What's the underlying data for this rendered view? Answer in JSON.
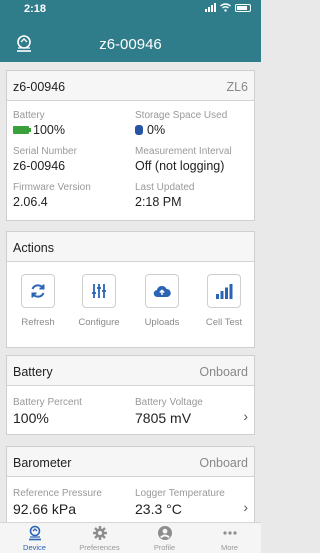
{
  "status_bar": {
    "time": "2:18"
  },
  "header": {
    "title": "z6-00946",
    "logo_icon": "meter-logo-icon"
  },
  "device": {
    "name": "z6-00946",
    "model": "ZL6",
    "fields": {
      "battery_label": "Battery",
      "battery_value": "100%",
      "storage_label": "Storage Space Used",
      "storage_value": "0%",
      "serial_label": "Serial Number",
      "serial_value": "z6-00946",
      "interval_label": "Measurement Interval",
      "interval_value": "Off (not logging)",
      "firmware_label": "Firmware Version",
      "firmware_value": "2.06.4",
      "updated_label": "Last Updated",
      "updated_value": "2:18 PM"
    }
  },
  "actions": {
    "title": "Actions",
    "items": [
      {
        "label": "Refresh",
        "icon": "refresh-icon"
      },
      {
        "label": "Configure",
        "icon": "sliders-icon"
      },
      {
        "label": "Uploads",
        "icon": "cloud-upload-icon"
      },
      {
        "label": "Cell Test",
        "icon": "signal-bars-icon"
      }
    ]
  },
  "battery_section": {
    "title": "Battery",
    "source": "Onboard",
    "percent_label": "Battery Percent",
    "percent_value": "100%",
    "voltage_label": "Battery Voltage",
    "voltage_value": "7805 mV"
  },
  "barometer_section": {
    "title": "Barometer",
    "source": "Onboard",
    "pressure_label": "Reference Pressure",
    "pressure_value": "92.66 kPa",
    "temp_label": "Logger Temperature",
    "temp_value": "23.3 °C"
  },
  "tabs": [
    {
      "label": "Device",
      "icon": "device-icon",
      "active": true
    },
    {
      "label": "Preferences",
      "icon": "gear-icon",
      "active": false
    },
    {
      "label": "Profile",
      "icon": "user-icon",
      "active": false
    },
    {
      "label": "More",
      "icon": "more-dots-icon",
      "active": false
    }
  ],
  "colors": {
    "header": "#2f7d8a",
    "accent": "#2a64b5",
    "battery_green": "#3aa03a"
  }
}
